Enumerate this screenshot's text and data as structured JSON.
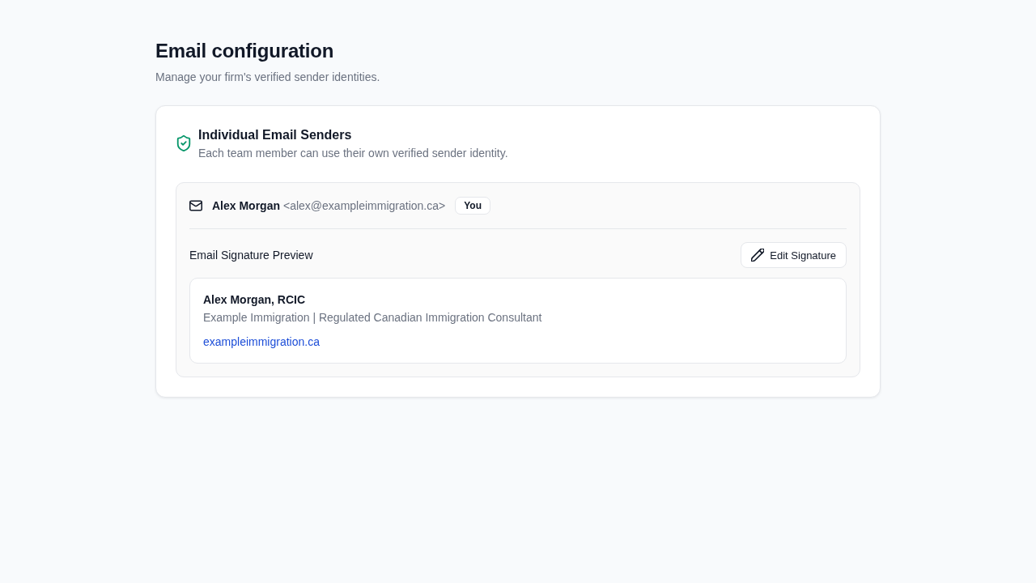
{
  "page": {
    "title": "Email configuration",
    "subtitle": "Manage your firm's verified sender identities."
  },
  "section": {
    "title": "Individual Email Senders",
    "description": "Each team member can use their own verified sender identity.",
    "senders": [
      {
        "name": "Alex Morgan",
        "email": "<alex@exampleimmigration.ca>",
        "badge": "You",
        "signature_heading": "Email Signature Preview",
        "edit_button": "Edit Signature",
        "signature": {
          "name_line": "Alex Morgan, RCIC",
          "company_line": "Example Immigration | Regulated Canadian Immigration Consultant",
          "link": "exampleimmigration.ca"
        }
      }
    ]
  }
}
